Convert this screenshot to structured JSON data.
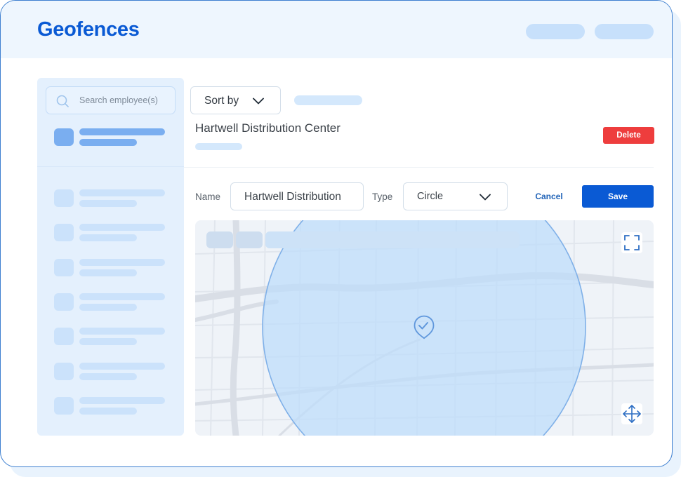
{
  "header": {
    "title": "Geofences"
  },
  "sidebar": {
    "search_placeholder": "Search employee(s)",
    "items_count_visible": 7
  },
  "toolbar": {
    "sort_label": "Sort by"
  },
  "geofence": {
    "name_title": "Hartwell Distribution Center",
    "delete_label": "Delete"
  },
  "form": {
    "name_label": "Name",
    "name_value": "Hartwell Distribution",
    "type_label": "Type",
    "type_value": "Circle",
    "cancel_label": "Cancel",
    "save_label": "Save"
  },
  "map": {
    "shape": "circle",
    "marker_icon": "shield-check-pin-icon",
    "controls": [
      "fullscreen-icon",
      "move-icon"
    ]
  },
  "colors": {
    "brand": "#0a5ad4",
    "danger": "#ee3d3d",
    "geofence_fill": "#bcdcfb",
    "geofence_stroke": "#7fb0e8"
  }
}
